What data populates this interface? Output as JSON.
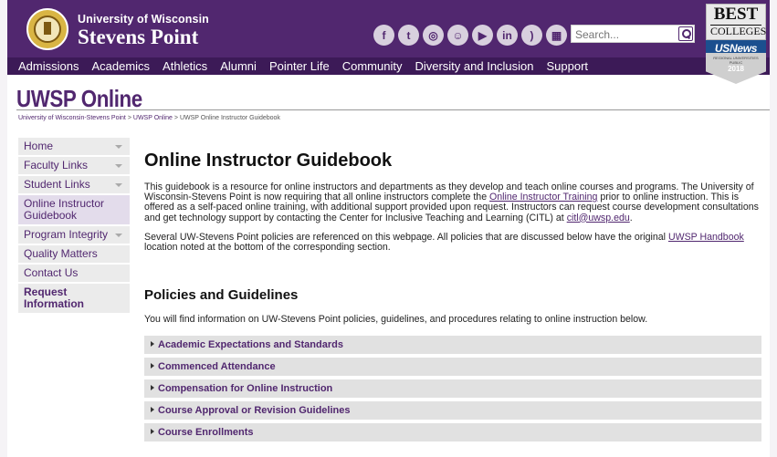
{
  "header": {
    "brand_line1": "University of Wisconsin",
    "brand_line2": "Stevens Point",
    "social_icons": [
      "facebook-icon",
      "twitter-icon",
      "instagram-icon",
      "snapchat-icon",
      "youtube-icon",
      "linkedin-icon",
      "rss-icon",
      "calendar-icon"
    ],
    "search_placeholder": "Search..."
  },
  "badge": {
    "best": "BEST",
    "colleges": "COLLEGES",
    "usnews": "USNews",
    "category": "REGIONAL UNIVERSITIES PUBLIC",
    "year": "2018"
  },
  "nav": {
    "items": [
      "Admissions",
      "Academics",
      "Athletics",
      "Alumni",
      "Pointer Life",
      "Community",
      "Diversity and Inclusion",
      "Support"
    ]
  },
  "site_title": "UWSP Online",
  "breadcrumb": {
    "items": [
      "University of Wisconsin-Stevens Point",
      "UWSP Online",
      "UWSP Online Instructor Guidebook"
    ],
    "separator": ">"
  },
  "sidebar": {
    "items": [
      {
        "label": "Home"
      },
      {
        "label": "Faculty Links"
      },
      {
        "label": "Student Links"
      },
      {
        "label": "Online Instructor Guidebook"
      },
      {
        "label": "Program Integrity"
      },
      {
        "label": "Quality Matters"
      },
      {
        "label": "Contact Us"
      },
      {
        "label": "Request Information"
      }
    ]
  },
  "main": {
    "title": "Online Instructor Guidebook",
    "para1_a": "This guidebook is a resource for online instructors and departments as they develop and teach online courses and programs. The University of Wisconsin-Stevens Point is now requiring that all online instructors complete the ",
    "para1_link": "Online Instructor Training",
    "para1_b": " prior to online instruction. This is offered as a self-paced online training, with additional support provided upon request. Instructors can request course development consultations and get technology support by contacting the Center for Inclusive Teaching and Learning (CITL) at ",
    "para1_email": "citl@uwsp.edu",
    "para1_c": ".",
    "para2_a": "Several UW-Stevens Point policies are referenced on this webpage. All policies that are discussed below have the original ",
    "para2_link": "UWSP Handbook",
    "para2_b": " location noted at the bottom of the corresponding section.",
    "section_title": "Policies and Guidelines",
    "section_intro": "You will find information on UW-Stevens Point policies, guidelines, and procedures relating to online instruction below.",
    "accordion": [
      "Academic Expectations and Standards",
      "Commenced Attendance",
      "Compensation for Online Instruction",
      "Course Approval or Revision Guidelines",
      "Course Enrollments"
    ]
  }
}
